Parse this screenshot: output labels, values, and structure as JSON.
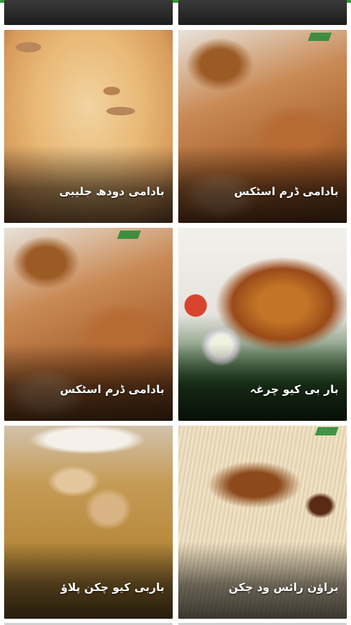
{
  "app": {
    "accent_color": "#2a9d2f"
  },
  "recipes": [
    {
      "title": "بادامی دودھ جلیبی",
      "image": "badami-doodh-jalebi-photo"
    },
    {
      "title": "بادامی ڈرم اسٹکس",
      "image": "badami-drumsticks-photo"
    },
    {
      "title": "بادامی ڈرم اسٹکس",
      "image": "badami-drumsticks-photo"
    },
    {
      "title": "بار بی کیو چرغہ",
      "image": "bbq-chargha-photo"
    },
    {
      "title": "باربی کیو چکن پلاؤ",
      "image": "bbq-chicken-pulao-photo"
    },
    {
      "title": "براؤن رائس ود چکن",
      "image": "brown-rice-chicken-photo"
    }
  ]
}
